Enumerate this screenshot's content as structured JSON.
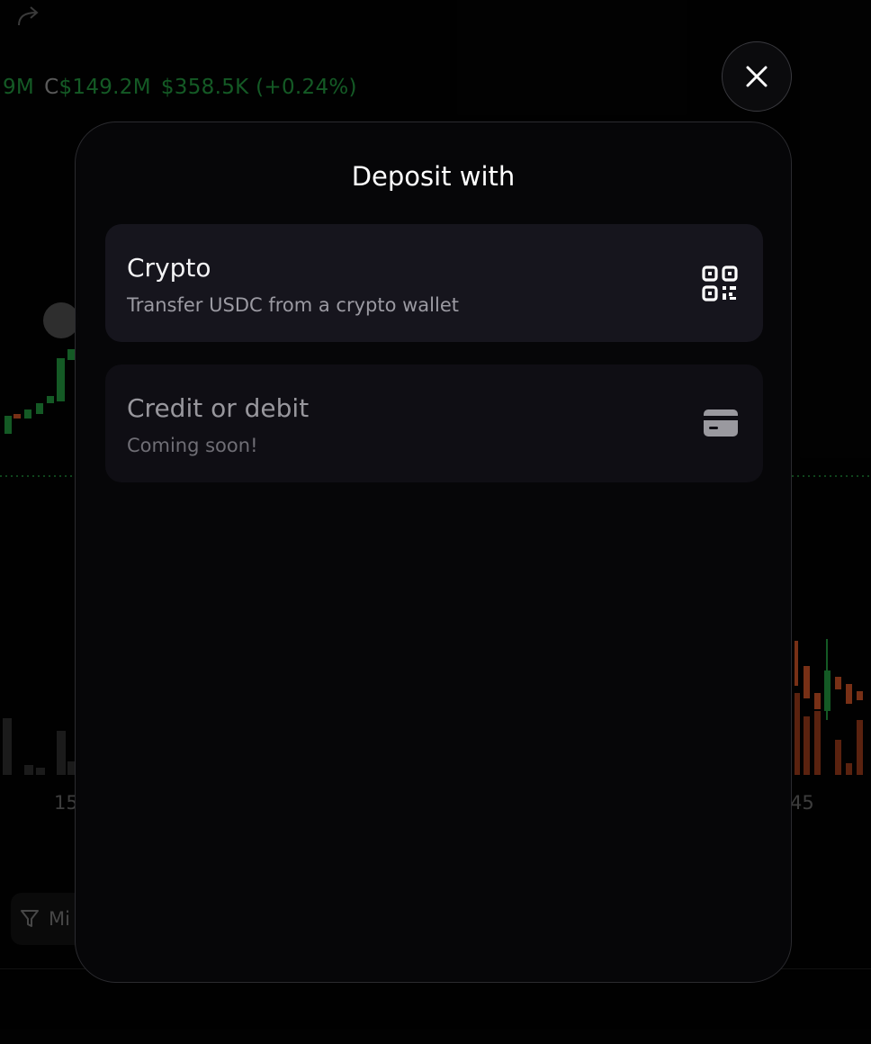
{
  "background": {
    "stats": {
      "volume_partial": "9M",
      "cap_prefix": "C",
      "market_cap": "$149.2M",
      "change": "$358.5K (+0.24%)"
    },
    "axis": {
      "left_tick": "15",
      "right_tick": "45"
    },
    "filter_label": "Mi"
  },
  "modal": {
    "title": "Deposit with",
    "options": [
      {
        "title": "Crypto",
        "subtitle": "Transfer USDC from a crypto wallet",
        "icon": "qr-code-icon",
        "enabled": true
      },
      {
        "title": "Credit or debit",
        "subtitle": "Coming soon!",
        "icon": "credit-card-icon",
        "enabled": false
      }
    ],
    "close_icon": "close-icon"
  },
  "colors": {
    "accent_green": "#1f8a3a",
    "candle_red": "#b84a22",
    "card_bg": "#16151d"
  }
}
